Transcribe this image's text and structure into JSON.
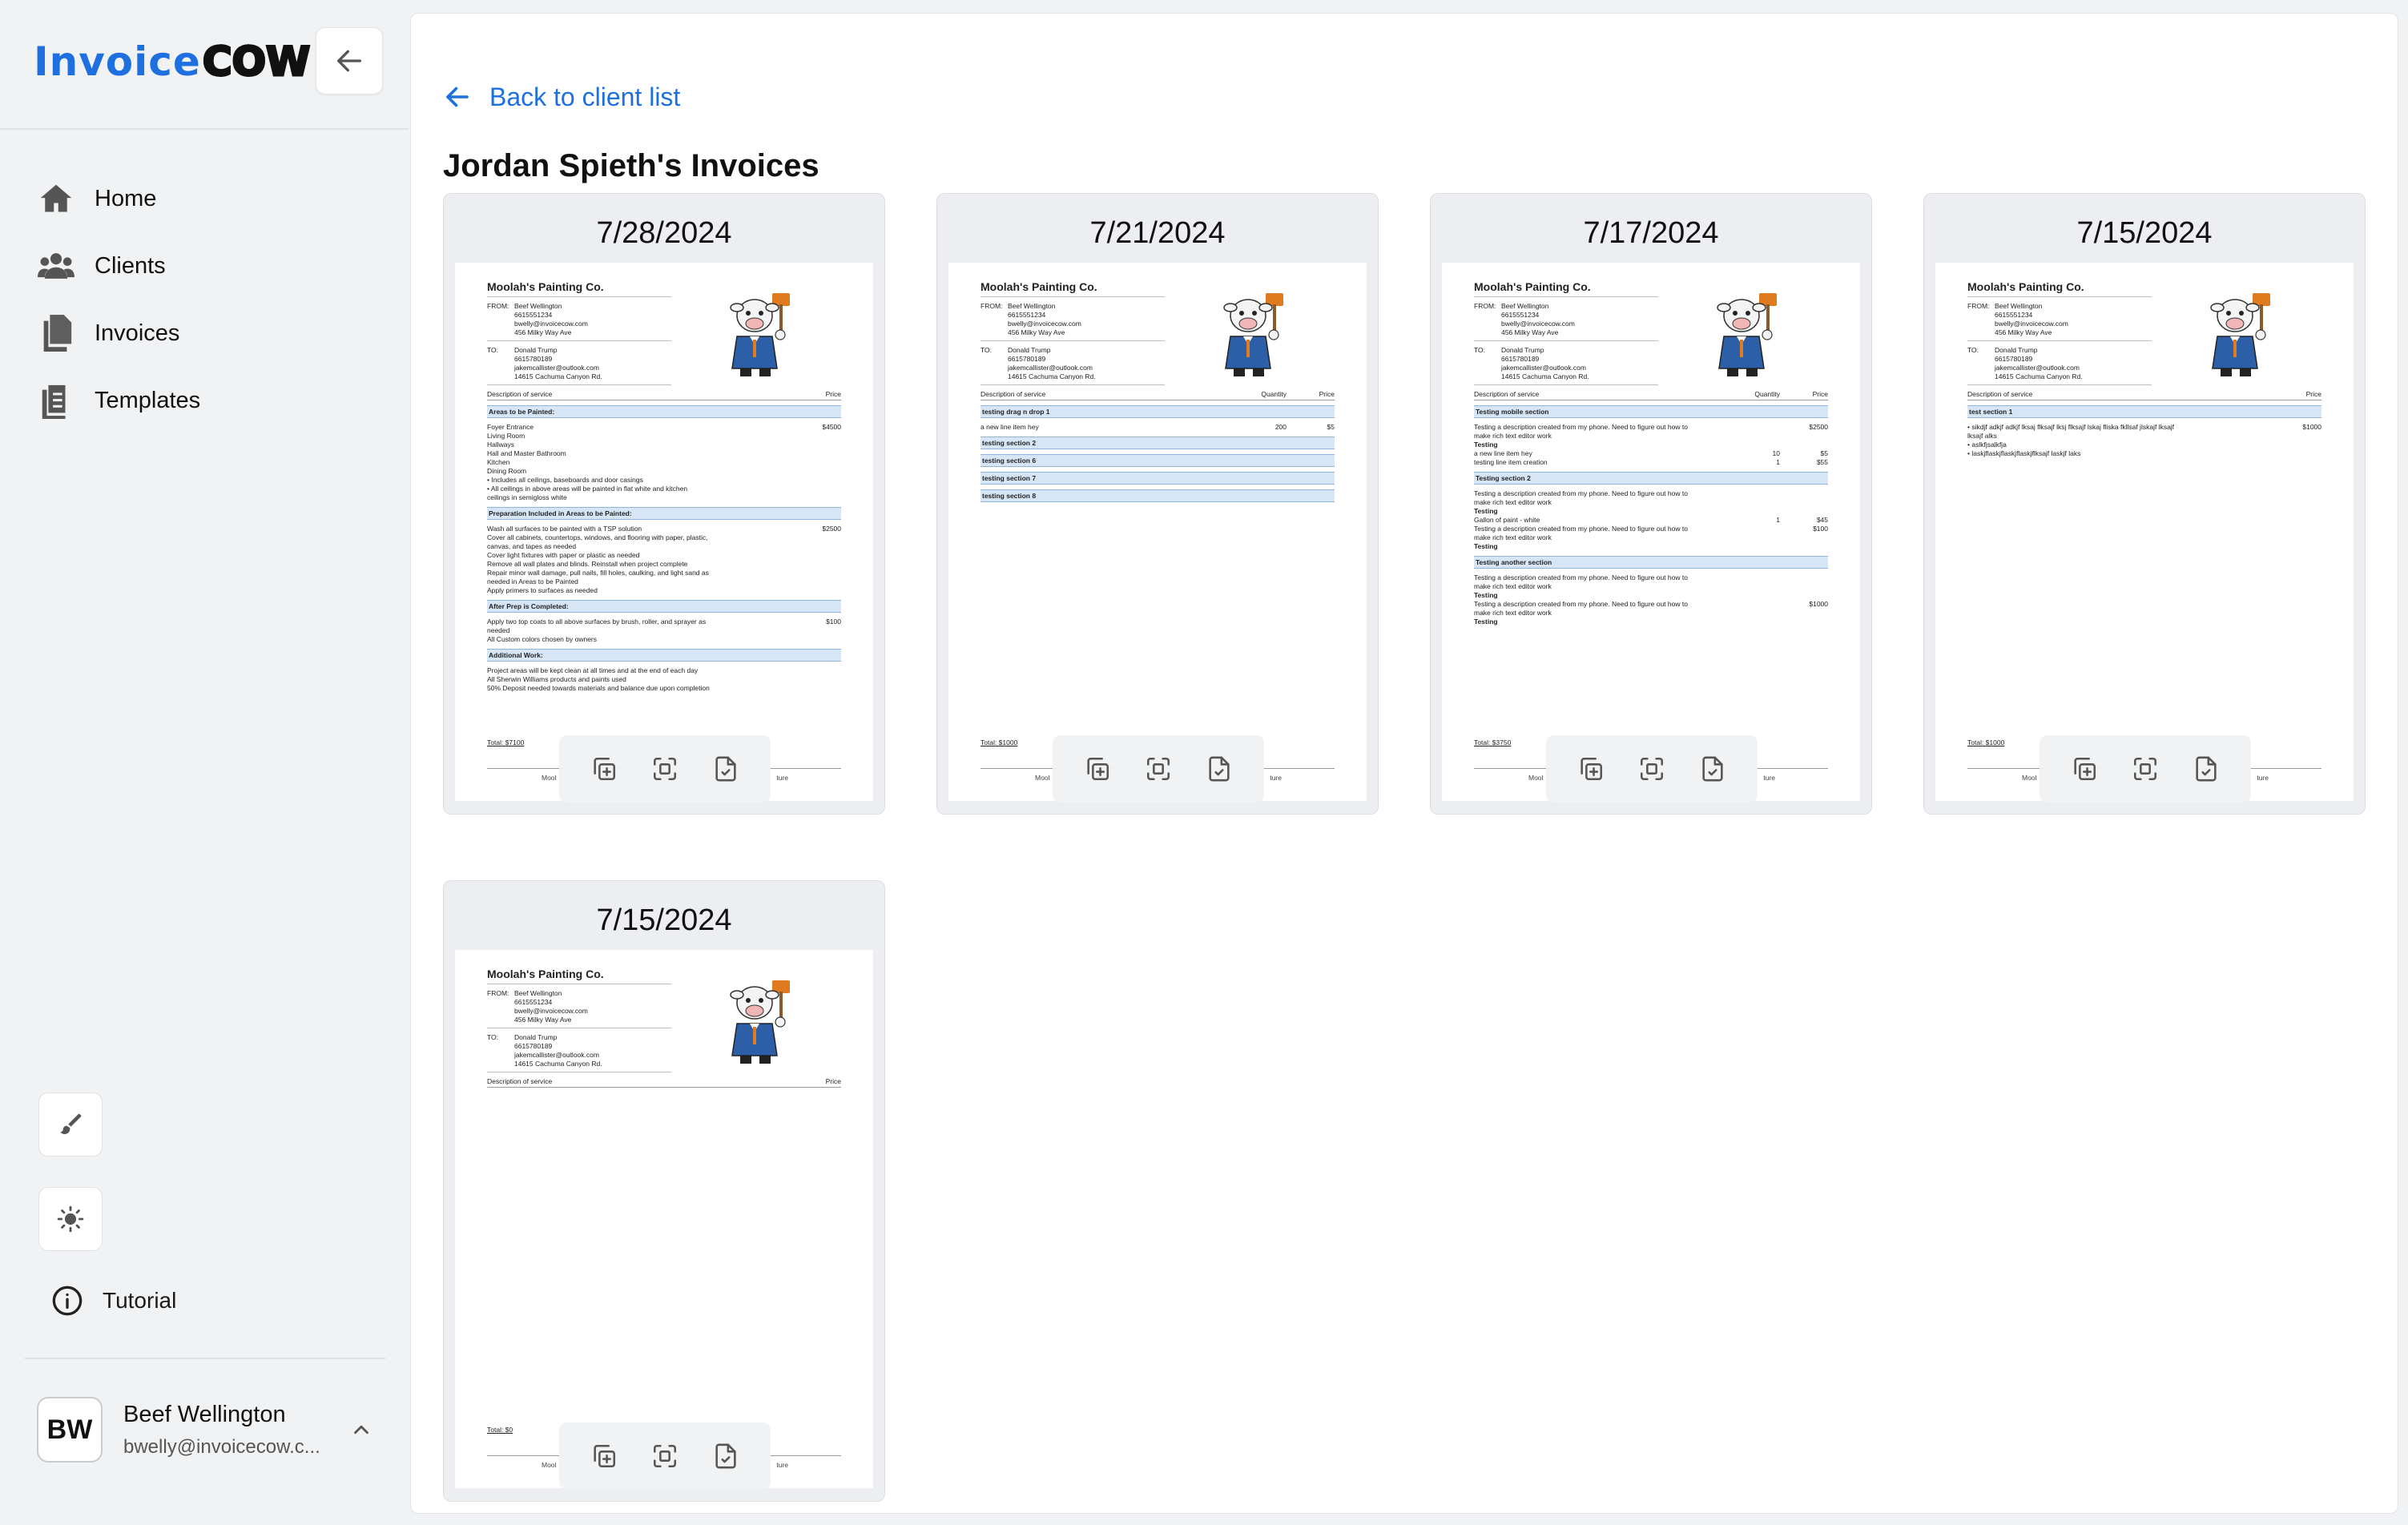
{
  "app": {
    "logo_prefix": "Invoice",
    "logo_suffix": "COW"
  },
  "sidebar": {
    "items": [
      {
        "label": "Home",
        "icon": "home-icon"
      },
      {
        "label": "Clients",
        "icon": "users-icon"
      },
      {
        "label": "Invoices",
        "icon": "files-icon"
      },
      {
        "label": "Templates",
        "icon": "clipboard-icon"
      }
    ],
    "tutorial_label": "Tutorial",
    "user": {
      "initials": "BW",
      "name": "Beef Wellington",
      "email": "bwelly@invoicecow.c..."
    }
  },
  "main": {
    "back_label": "Back to client list",
    "title": "Jordan Spieth's Invoices"
  },
  "invoice_common": {
    "company": "Moolah's Painting Co.",
    "from_label": "FROM:",
    "to_label": "TO:",
    "from": [
      "Beef Wellington",
      "6615551234",
      "bwelly@invoicecow.com",
      "456 Milky Way Ave"
    ],
    "to": [
      "Donald Trump",
      "6615780189",
      "jakemcallister@outlook.com",
      "14615 Cachuma Canyon Rd."
    ],
    "desc_header": "Description of service",
    "qty_header": "Quantity",
    "price_header": "Price",
    "sig_left": "Mool",
    "sig_right": "ture"
  },
  "invoices": [
    {
      "date": "7/28/2024",
      "total": "Total: $7100",
      "show_qty": false,
      "sections": [
        {
          "title": "Areas to be Painted:",
          "lines": [
            {
              "d": "Foyer Entrance",
              "q": "",
              "p": "$4500"
            },
            {
              "d": "Living Room",
              "q": "",
              "p": ""
            },
            {
              "d": "Hallways",
              "q": "",
              "p": ""
            },
            {
              "d": "Hall and Master Bathroom",
              "q": "",
              "p": ""
            },
            {
              "d": "Kitchen",
              "q": "",
              "p": ""
            },
            {
              "d": "Dining Room",
              "q": "",
              "p": ""
            },
            {
              "d": "  • Includes all ceilings, baseboards and door casings",
              "q": "",
              "p": ""
            },
            {
              "d": "  • All ceilings in above areas will be painted in flat white and kitchen",
              "q": "",
              "p": ""
            },
            {
              "d": "     ceilings in semigloss white",
              "q": "",
              "p": ""
            }
          ]
        },
        {
          "title": "Preparation Included in Areas to be Painted:",
          "lines": [
            {
              "d": "Wash all surfaces to be painted with a TSP solution",
              "q": "",
              "p": "$2500"
            },
            {
              "d": "Cover all cabinets, countertops, windows, and flooring with paper, plastic,",
              "q": "",
              "p": ""
            },
            {
              "d": "canvas, and tapes as needed",
              "q": "",
              "p": ""
            },
            {
              "d": "Cover light fixtures with paper or plastic as needed",
              "q": "",
              "p": ""
            },
            {
              "d": "Remove all wall plates and blinds. Reinstall when project complete",
              "q": "",
              "p": ""
            },
            {
              "d": "Repair minor wall damage, pull nails, fill holes, caulking, and light sand as",
              "q": "",
              "p": ""
            },
            {
              "d": "needed in Areas to be Painted",
              "q": "",
              "p": ""
            },
            {
              "d": "Apply primers to surfaces as needed",
              "q": "",
              "p": ""
            }
          ]
        },
        {
          "title": "After Prep is Completed:",
          "lines": [
            {
              "d": "Apply two top coats to all above surfaces by brush, roller, and sprayer as",
              "q": "",
              "p": "$100"
            },
            {
              "d": "needed",
              "q": "",
              "p": ""
            },
            {
              "d": "All Custom colors chosen by owners",
              "q": "",
              "p": ""
            }
          ]
        },
        {
          "title": "Additional Work:",
          "lines": [
            {
              "d": "Project areas will be kept clean at all times and at the end of each day",
              "q": "",
              "p": ""
            },
            {
              "d": "All Sherwin Williams products and paints used",
              "q": "",
              "p": ""
            },
            {
              "d": "50% Deposit needed towards materials and balance due upon completion",
              "q": "",
              "p": ""
            }
          ]
        }
      ]
    },
    {
      "date": "7/21/2024",
      "total": "Total: $1000",
      "show_qty": true,
      "sections": [
        {
          "title": "testing drag n drop 1",
          "lines": [
            {
              "d": "a new line item hey",
              "q": "200",
              "p": "$5"
            }
          ]
        },
        {
          "title": "testing section 2",
          "lines": []
        },
        {
          "title": "testing section 6",
          "lines": []
        },
        {
          "title": "testing section 7",
          "lines": []
        },
        {
          "title": "testing section 8",
          "lines": []
        }
      ]
    },
    {
      "date": "7/17/2024",
      "total": "Total: $3750",
      "show_qty": true,
      "sections": [
        {
          "title": "Testing mobile section",
          "lines": [
            {
              "d": "Testing a description created from my phone. Need to figure out how to",
              "q": "",
              "p": "$2500"
            },
            {
              "d": "make rich text editor work",
              "q": "",
              "p": ""
            },
            {
              "d": "Testing",
              "q": "",
              "p": ""
            },
            {
              "d": "a new line item hey",
              "q": "10",
              "p": "$5"
            },
            {
              "d": "testing line item creation",
              "q": "1",
              "p": "$55"
            }
          ]
        },
        {
          "title": "Testing section 2",
          "lines": [
            {
              "d": "Testing a description created from my phone. Need to figure out how to",
              "q": "",
              "p": ""
            },
            {
              "d": "make rich text editor work",
              "q": "",
              "p": ""
            },
            {
              "d": "Testing",
              "q": "",
              "p": ""
            },
            {
              "d": "Gallon of paint - white",
              "q": "1",
              "p": "$45"
            },
            {
              "d": "Testing a description created from my phone. Need to figure out how to",
              "q": "",
              "p": "$100"
            },
            {
              "d": "make rich text editor work",
              "q": "",
              "p": ""
            },
            {
              "d": "Testing",
              "q": "",
              "p": ""
            }
          ]
        },
        {
          "title": "Testing another section",
          "lines": [
            {
              "d": "Testing a description created from my phone. Need to figure out how to",
              "q": "",
              "p": ""
            },
            {
              "d": "make rich text editor work",
              "q": "",
              "p": ""
            },
            {
              "d": "Testing",
              "q": "",
              "p": ""
            },
            {
              "d": "Testing a description created from my phone. Need to figure out how to",
              "q": "",
              "p": "$1000"
            },
            {
              "d": "make rich text editor work",
              "q": "",
              "p": ""
            },
            {
              "d": "Testing",
              "q": "",
              "p": ""
            }
          ]
        }
      ]
    },
    {
      "date": "7/15/2024",
      "total": "Total: $1000",
      "show_qty": false,
      "sections": [
        {
          "title": "test section 1",
          "lines": [
            {
              "d": "  • sikdjf adkjf adkjf lksaj flksajf lksj flksajf lskaj fliska fkllsaf jlskajf lksajf",
              "q": "",
              "p": "$1000"
            },
            {
              "d": "     lksajf alks",
              "q": "",
              "p": ""
            },
            {
              "d": "  • aslkfjsalkfja",
              "q": "",
              "p": ""
            },
            {
              "d": "  • laskjflaskjflaskjflaskjflksajf laskjf laks",
              "q": "",
              "p": ""
            }
          ]
        }
      ]
    },
    {
      "date": "7/15/2024",
      "total": "Total: $0",
      "show_qty": false,
      "sections": []
    }
  ],
  "colors": {
    "accent": "#1e6fe0",
    "section_bg": "#d7e6f7"
  }
}
